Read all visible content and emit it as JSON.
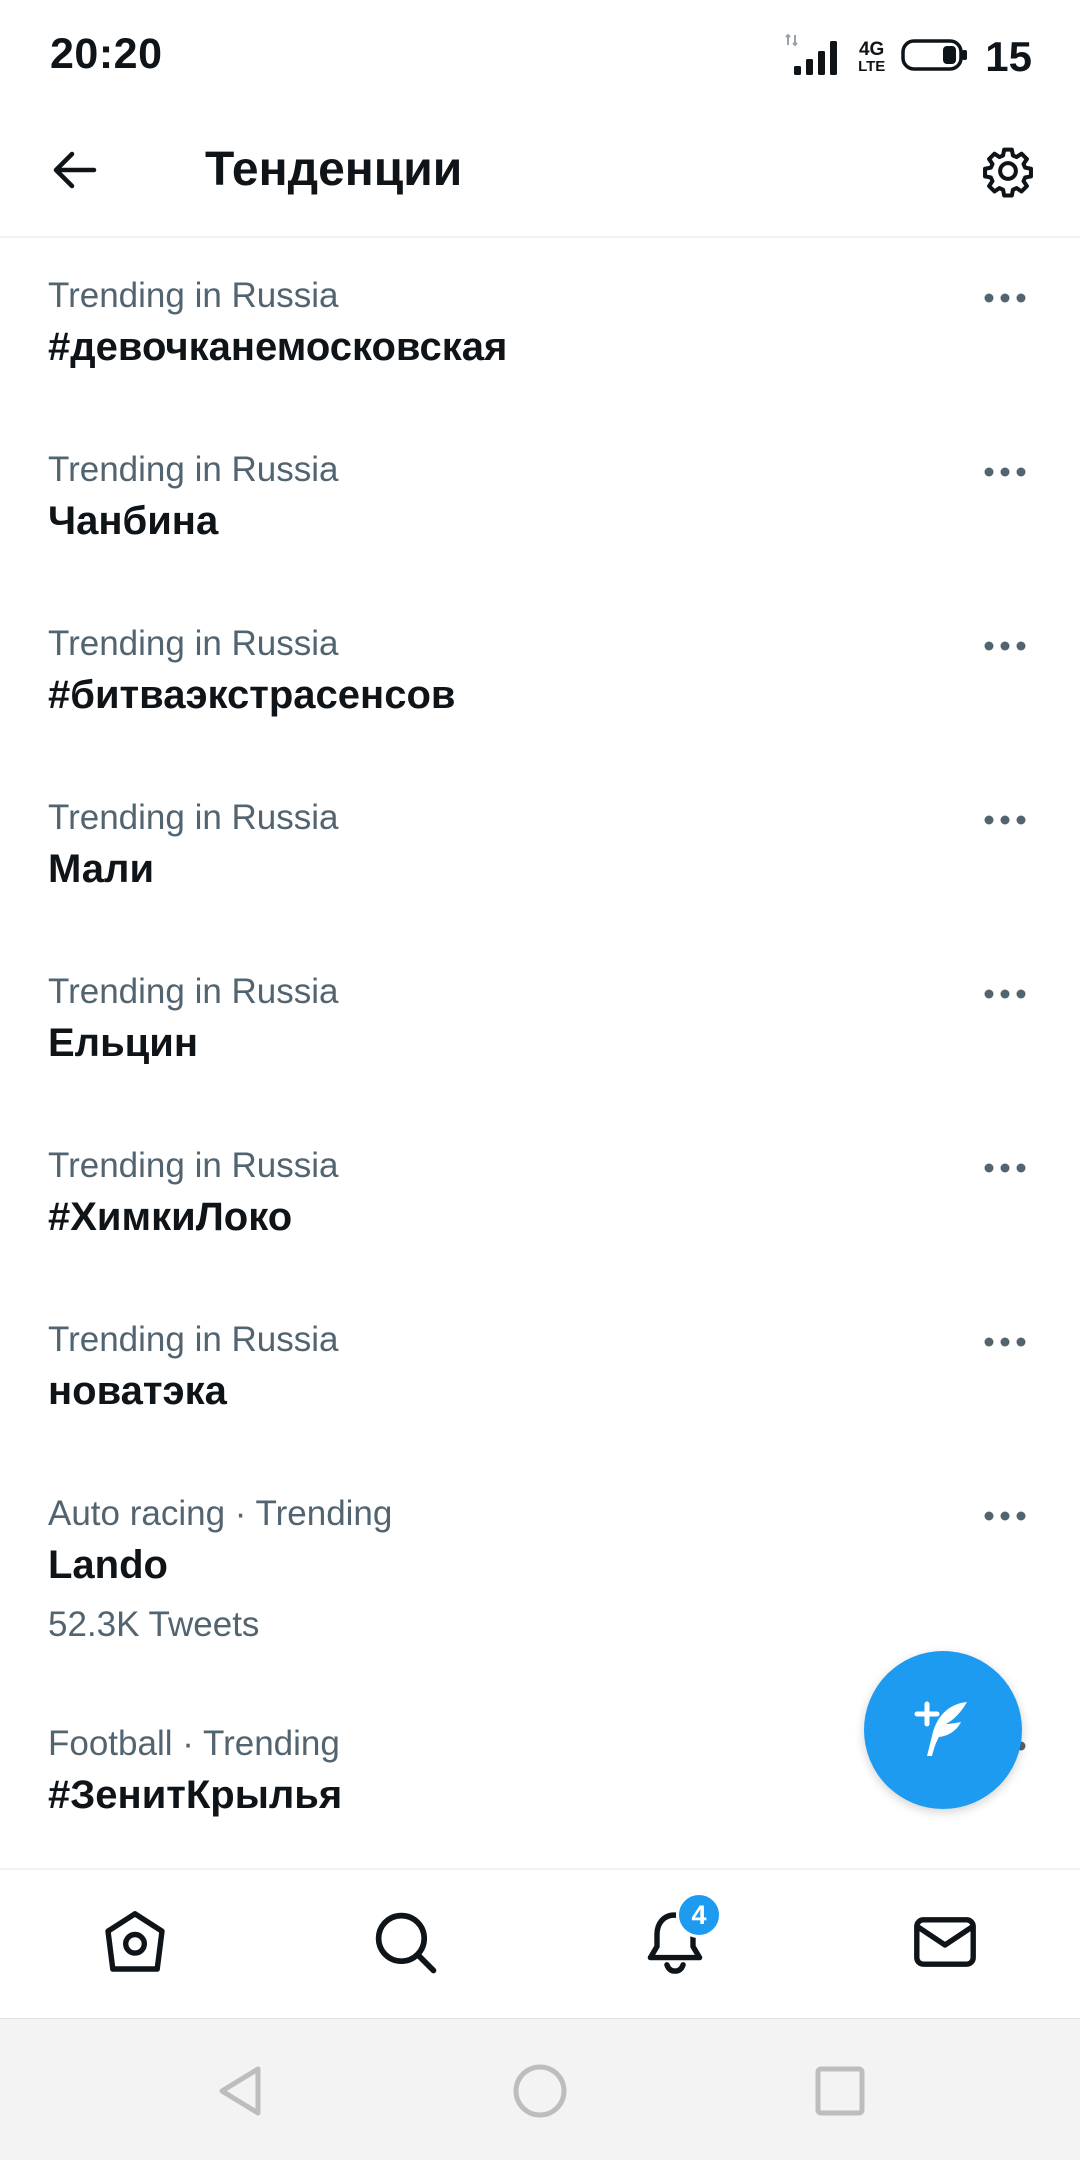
{
  "status_bar": {
    "time": "20:20",
    "battery_level": "15",
    "network_top": "4G",
    "network_bottom": "LTE",
    "icons": [
      "signal-icon",
      "network-type-icon",
      "battery-icon"
    ]
  },
  "header": {
    "title": "Тенденции",
    "back_icon": "arrow-left-icon",
    "settings_icon": "gear-icon"
  },
  "trends": [
    {
      "context": "Trending in Russia",
      "name": "#девочканемосковская"
    },
    {
      "context": "Trending in Russia",
      "name": "Чанбина"
    },
    {
      "context": "Trending in Russia",
      "name": "#битваэкстрасенсов"
    },
    {
      "context": "Trending in Russia",
      "name": "Мали"
    },
    {
      "context": "Trending in Russia",
      "name": "Ельцин"
    },
    {
      "context": "Trending in Russia",
      "name": "#ХимкиЛоко"
    },
    {
      "context": "Trending in Russia",
      "name": "новатэка"
    },
    {
      "context": "Auto racing · Trending",
      "name": "Lando",
      "count": "52.3K Tweets"
    },
    {
      "context": "Football · Trending",
      "name": "#ЗенитКрылья"
    }
  ],
  "fab": {
    "icon": "compose-tweet-icon"
  },
  "bottom_nav": {
    "tabs": [
      "home-icon",
      "search-icon",
      "bell-icon",
      "mail-icon"
    ],
    "notification_badge": "4"
  },
  "system_nav": {
    "buttons": [
      "back-triangle-icon",
      "home-circle-icon",
      "recents-square-icon"
    ]
  },
  "colors": {
    "accent": "#1d9bf0",
    "text_primary": "#0f1419",
    "text_secondary": "#536471",
    "divider": "#eff3f4"
  }
}
